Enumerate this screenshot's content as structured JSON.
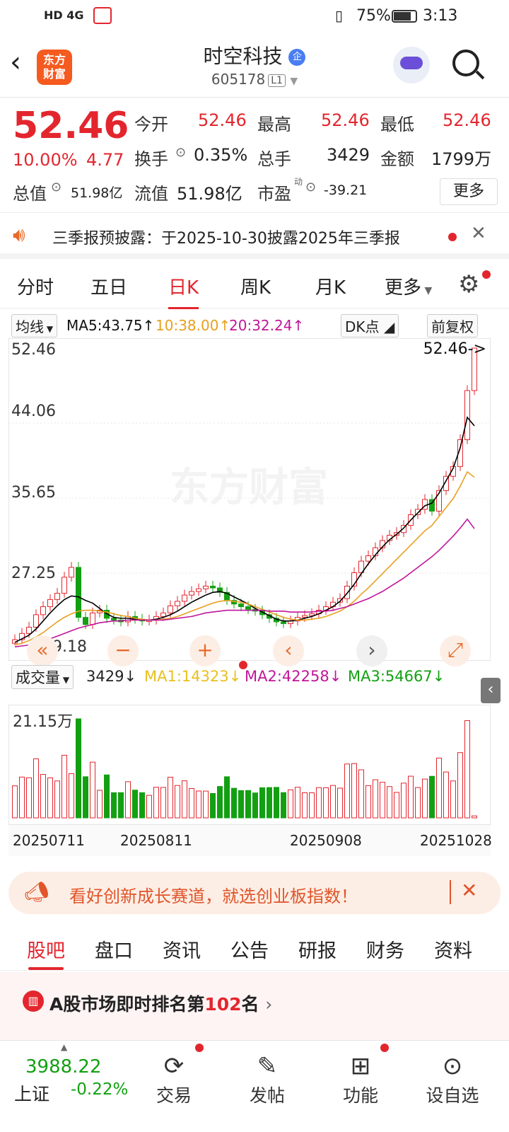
{
  "status_bar": {
    "left_icons": "HD 4G",
    "battery": "75%",
    "time": "3:13"
  },
  "header": {
    "logo_line1": "东方",
    "logo_line2": "财富",
    "title": "时空科技",
    "badge": "企",
    "code": "605178",
    "level": "L1"
  },
  "quote": {
    "price": "52.46",
    "change_pct": "10.00%",
    "change": "4.77",
    "open_label": "今开",
    "open": "52.46",
    "high_label": "最高",
    "high": "52.46",
    "low_label": "最低",
    "low": "52.46",
    "turnover_label": "换手",
    "turnover": "0.35%",
    "volume_label": "总手",
    "volume": "3429",
    "amount_label": "金额",
    "amount": "1799万",
    "mktcap_label": "总值",
    "mktcap": "51.98亿",
    "float_label": "流值",
    "float": "51.98亿",
    "pe_label": "市盈",
    "pe_sup": "动",
    "pe": "-39.21",
    "more": "更多"
  },
  "notice": {
    "text": "三季报预披露：于2025-10-30披露2025年三季报"
  },
  "chart_tabs": [
    "分时",
    "五日",
    "日K",
    "周K",
    "月K",
    "更多"
  ],
  "ma_line": {
    "selector": "均线",
    "ma5": "MA5:43.75",
    "ma10": "10:38.00",
    "ma20": "20:32.24",
    "dk": "DK点",
    "adjust": "前复权"
  },
  "price_axis": [
    "52.46",
    "44.06",
    "35.65",
    "27.25",
    "19.18"
  ],
  "last_price_marker": "52.46->",
  "vol_line": {
    "selector": "成交量",
    "vol": "3429",
    "ma1": "MA1:14323",
    "ma2": "MA2:42258",
    "ma3": "MA3:54667"
  },
  "vol_axis": "21.15万",
  "dates": [
    "20250711",
    "20250811",
    "20250908",
    "20251028"
  ],
  "watermark": "东方财富",
  "promo": {
    "text": "看好创新成长赛道，就选创业板指数！"
  },
  "bottom_tabs": [
    "股吧",
    "盘口",
    "资讯",
    "公告",
    "研报",
    "财务",
    "资料"
  ],
  "rank": {
    "prefix": "A股市场即时排名第",
    "num": "102",
    "suffix": "名"
  },
  "index": {
    "value": "3988.22",
    "name": "上证",
    "change": "-0.22%"
  },
  "nav": [
    "交易",
    "发帖",
    "功能",
    "设自选"
  ],
  "colors": {
    "up": "#e3262e",
    "down": "#12a012",
    "ma5": "#000000",
    "ma10": "#e8a020",
    "ma20": "#c0169a"
  },
  "chart_data": {
    "type": "candlestick",
    "y_range": [
      19.18,
      52.46
    ],
    "x_labels": [
      "20250711",
      "20250811",
      "20250908",
      "20251028"
    ],
    "close": [
      19.8,
      20.5,
      21.2,
      22.6,
      23.5,
      24.3,
      25.0,
      26.8,
      27.9,
      22.3,
      21.5,
      22.8,
      23.1,
      22.2,
      22.0,
      21.8,
      22.4,
      22.1,
      21.9,
      22.0,
      22.4,
      22.8,
      23.6,
      24.1,
      24.8,
      25.2,
      25.5,
      25.8,
      25.6,
      25.1,
      24.2,
      23.8,
      23.5,
      23.2,
      23.0,
      22.6,
      22.2,
      21.8,
      21.6,
      21.9,
      22.3,
      22.5,
      22.7,
      23.1,
      23.5,
      24.0,
      24.4,
      25.8,
      27.3,
      28.6,
      29.2,
      30.1,
      30.9,
      31.5,
      31.8,
      32.6,
      33.8,
      34.4,
      35.5,
      34.2,
      36.5,
      38.1,
      39.2,
      42.2,
      47.7,
      52.46
    ],
    "ma5": [
      19.5,
      19.9,
      20.3,
      21.0,
      21.9,
      22.8,
      23.6,
      24.3,
      24.7,
      24.6,
      24.2,
      23.9,
      23.3,
      22.7,
      22.3,
      22.2,
      22.2,
      22.1,
      22.0,
      22.0,
      22.1,
      22.3,
      22.6,
      23.0,
      23.5,
      24.0,
      24.4,
      24.8,
      25.1,
      25.2,
      25.0,
      24.6,
      24.2,
      23.8,
      23.3,
      22.9,
      22.5,
      22.1,
      21.9,
      21.9,
      22.0,
      22.2,
      22.4,
      22.7,
      23.1,
      23.5,
      24.1,
      25.0,
      26.0,
      27.2,
      28.3,
      29.3,
      30.2,
      31.0,
      31.6,
      32.3,
      33.2,
      34.0,
      34.8,
      35.1,
      36.2,
      37.6,
      39.0,
      41.3,
      44.7,
      43.75
    ],
    "ma10": [
      19.2,
      19.4,
      19.7,
      20.1,
      20.6,
      21.2,
      21.8,
      22.3,
      22.7,
      23.0,
      23.1,
      23.1,
      23.0,
      22.9,
      22.7,
      22.5,
      22.4,
      22.2,
      22.1,
      22.0,
      22.0,
      22.1,
      22.2,
      22.4,
      22.7,
      23.0,
      23.3,
      23.6,
      23.9,
      24.1,
      24.2,
      24.1,
      24.0,
      23.8,
      23.5,
      23.2,
      22.9,
      22.6,
      22.3,
      22.1,
      22.0,
      22.0,
      22.1,
      22.2,
      22.4,
      22.7,
      23.0,
      23.5,
      24.1,
      24.9,
      25.6,
      26.4,
      27.2,
      28.0,
      28.8,
      29.6,
      30.4,
      31.2,
      32.0,
      32.6,
      33.6,
      34.6,
      35.6,
      37.0,
      38.6,
      38.0
    ],
    "ma20": [
      19.0,
      19.1,
      19.2,
      19.4,
      19.6,
      19.9,
      20.2,
      20.5,
      20.8,
      21.1,
      21.3,
      21.5,
      21.7,
      21.8,
      21.9,
      21.9,
      22.0,
      22.0,
      22.0,
      22.0,
      22.0,
      22.0,
      22.1,
      22.2,
      22.3,
      22.4,
      22.6,
      22.8,
      22.9,
      23.0,
      23.1,
      23.1,
      23.1,
      23.1,
      23.1,
      23.1,
      23.0,
      23.0,
      23.0,
      22.9,
      22.9,
      22.9,
      22.9,
      23.0,
      23.0,
      23.1,
      23.3,
      23.5,
      23.8,
      24.1,
      24.4,
      24.8,
      25.2,
      25.7,
      26.2,
      26.7,
      27.3,
      27.9,
      28.5,
      29.1,
      29.8,
      30.6,
      31.4,
      32.3,
      33.3,
      32.24
    ],
    "volume_max": "21.15万"
  }
}
